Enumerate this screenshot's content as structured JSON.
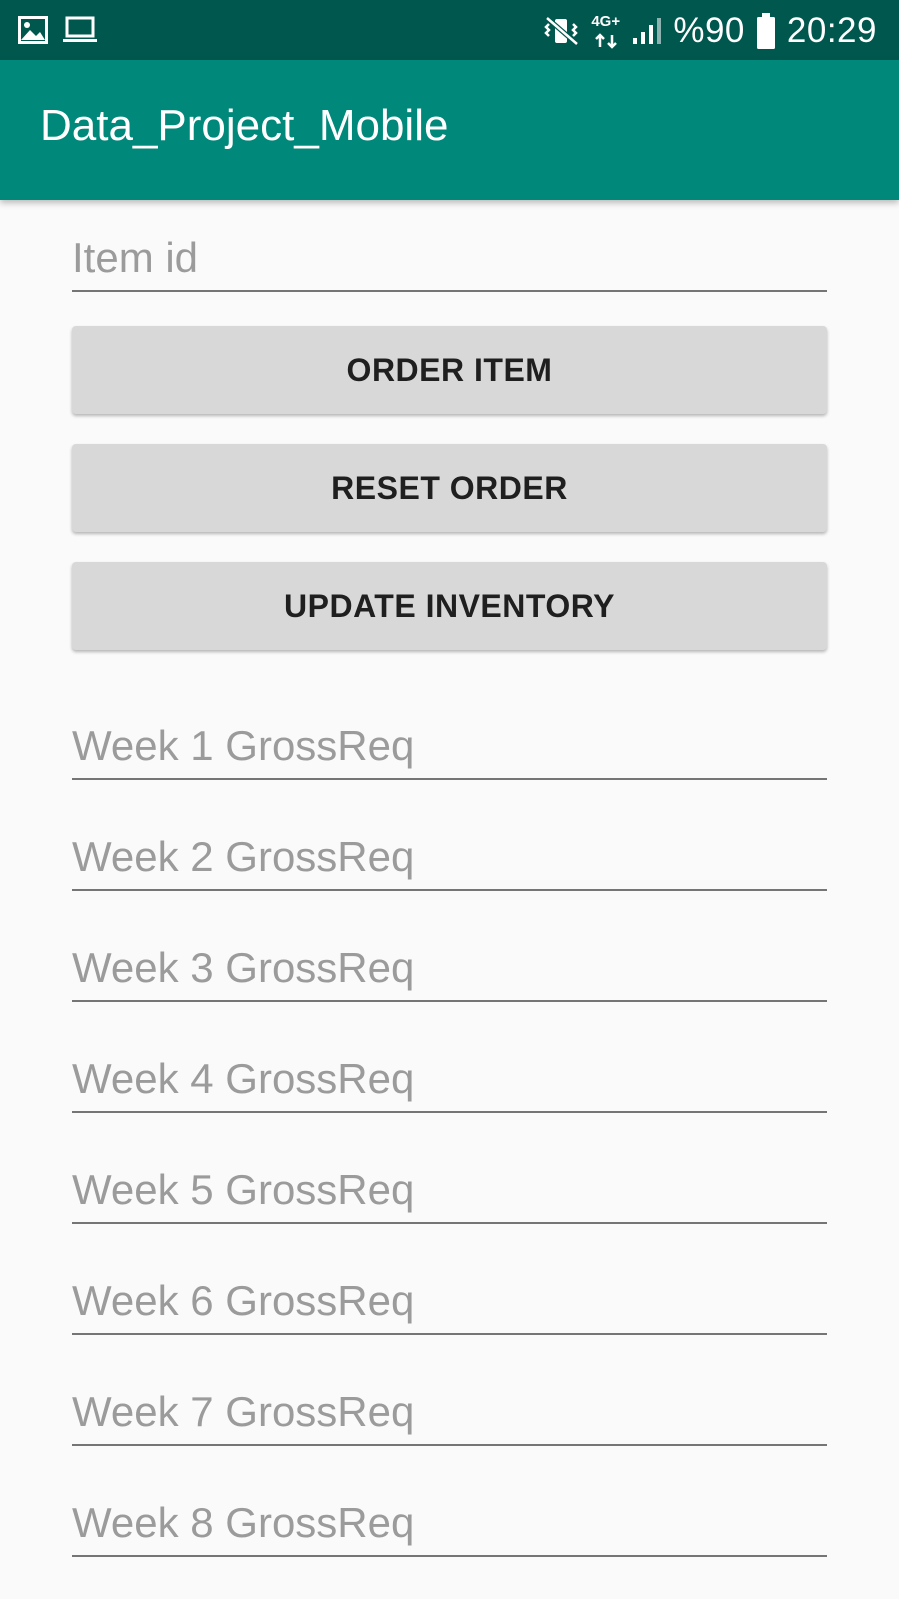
{
  "status_bar": {
    "left_icons": [
      "image-icon",
      "laptop-icon"
    ],
    "right_icons": [
      "vibrate-icon",
      "network-4g-icon",
      "signal-icon",
      "battery-icon"
    ],
    "network_label": "4G+",
    "battery": "%90",
    "time": "20:29"
  },
  "app_bar": {
    "title": "Data_Project_Mobile",
    "color": "#00887a"
  },
  "form": {
    "item_id_placeholder": "Item id",
    "buttons": {
      "order_item": "ORDER ITEM",
      "reset_order": "RESET ORDER",
      "update_inventory": "UPDATE INVENTORY"
    },
    "week_fields": [
      "Week 1 GrossReq",
      "Week 2 GrossReq",
      "Week 3 GrossReq",
      "Week 4 GrossReq",
      "Week 5 GrossReq",
      "Week 6 GrossReq",
      "Week 7 GrossReq",
      "Week 8 GrossReq"
    ]
  },
  "colors": {
    "status_bar": "#00574e",
    "app_bar": "#00887a",
    "button": "#d8d8d8",
    "background": "#fafafa"
  }
}
